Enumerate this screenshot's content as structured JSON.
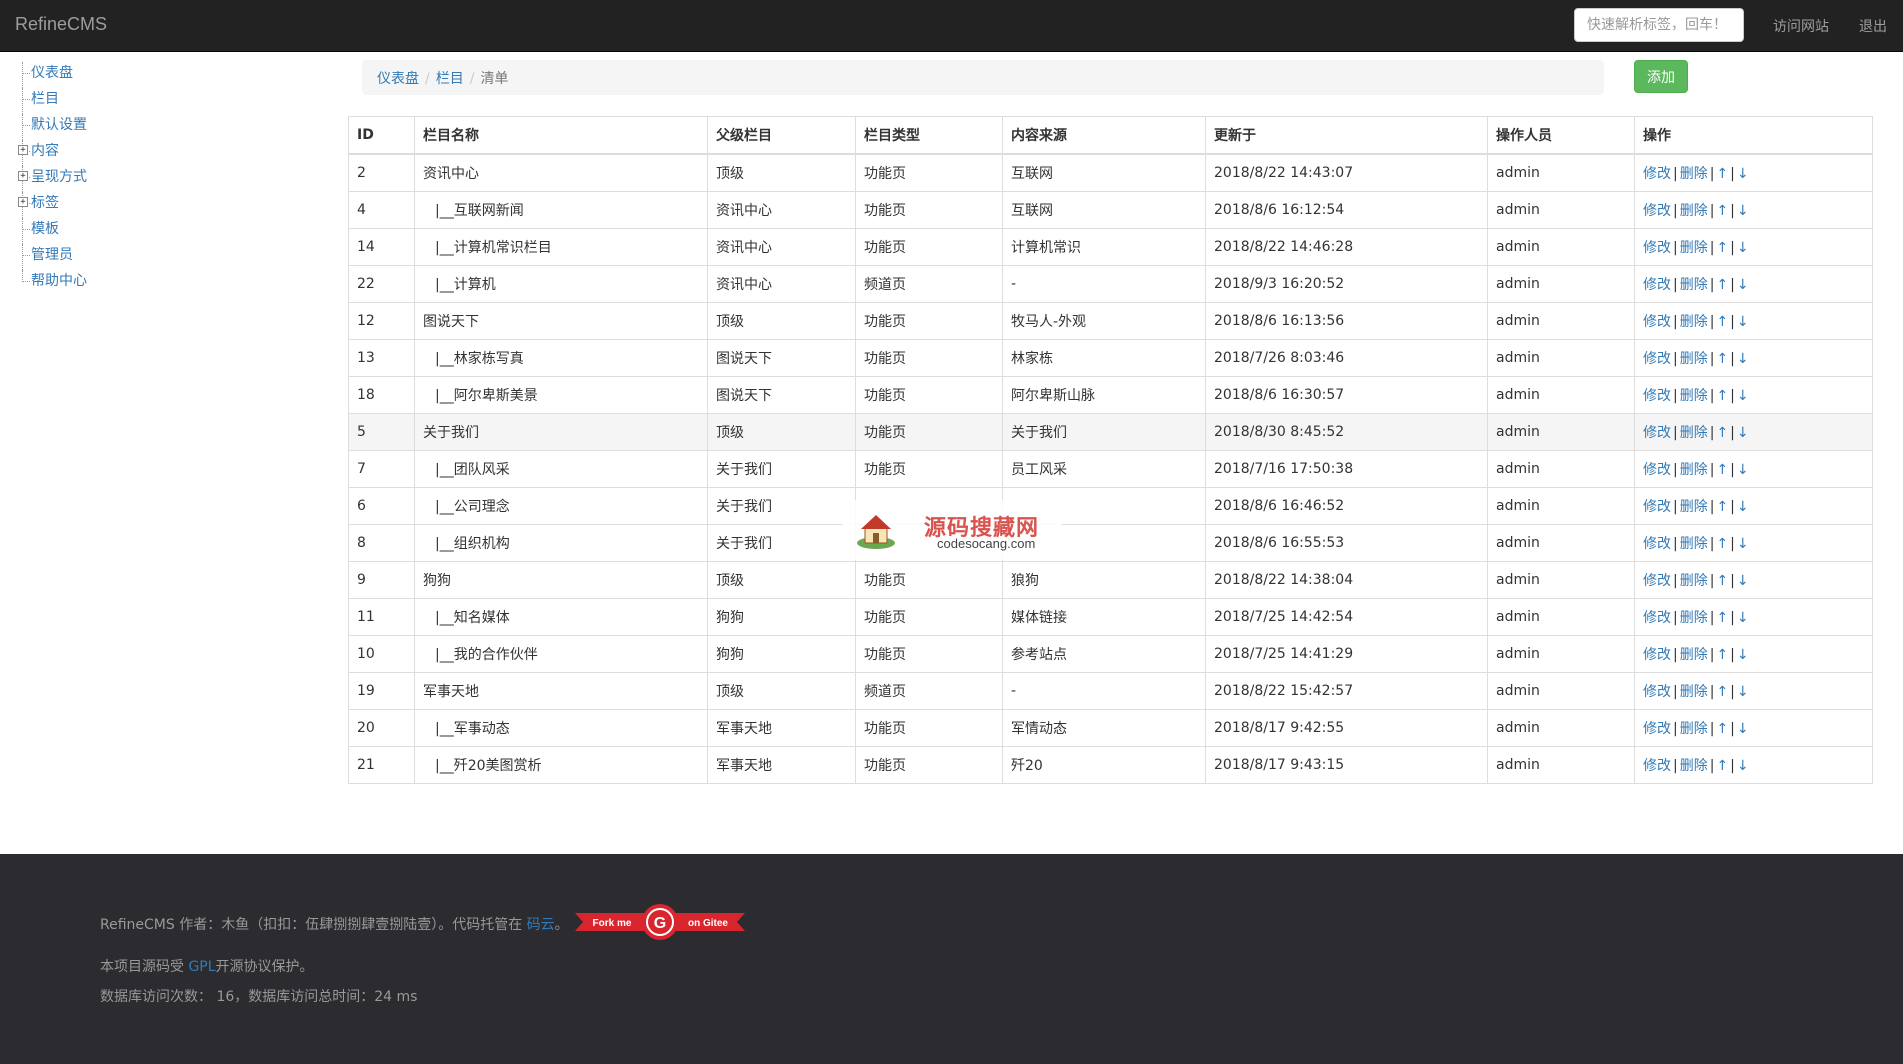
{
  "app": {
    "brand": "RefineCMS",
    "search_placeholder": "快速解析标签，回车！",
    "visit_site": "访问网站",
    "logout": "退出"
  },
  "sidebar": {
    "items": [
      {
        "label": "仪表盘",
        "expandable": false
      },
      {
        "label": "栏目",
        "expandable": false
      },
      {
        "label": "默认设置",
        "expandable": false
      },
      {
        "label": "内容",
        "expandable": true
      },
      {
        "label": "呈现方式",
        "expandable": true
      },
      {
        "label": "标签",
        "expandable": true
      },
      {
        "label": "模板",
        "expandable": false
      },
      {
        "label": "管理员",
        "expandable": false
      },
      {
        "label": "帮助中心",
        "expandable": false
      }
    ],
    "expander_glyph": "+"
  },
  "breadcrumb": {
    "items": [
      "仪表盘",
      "栏目"
    ],
    "active": "清单",
    "separator": "/"
  },
  "toolbar": {
    "add_label": "添加"
  },
  "table": {
    "headers": [
      "ID",
      "栏目名称",
      "父级栏目",
      "栏目类型",
      "内容来源",
      "更新于",
      "操作人员",
      "操作"
    ],
    "ops": {
      "edit": "修改",
      "delete": "删除",
      "sep": "|",
      "up": "↑",
      "down": "↓"
    },
    "rows": [
      [
        "2",
        "资讯中心",
        "顶级",
        "功能页",
        "互联网",
        "2018/8/22 14:43:07",
        "admin"
      ],
      [
        "4",
        "|__互联网新闻",
        "资讯中心",
        "功能页",
        "互联网",
        "2018/8/6 16:12:54",
        "admin"
      ],
      [
        "14",
        "|__计算机常识栏目",
        "资讯中心",
        "功能页",
        "计算机常识",
        "2018/8/22 14:46:28",
        "admin"
      ],
      [
        "22",
        "|__计算机",
        "资讯中心",
        "频道页",
        "-",
        "2018/9/3 16:20:52",
        "admin"
      ],
      [
        "12",
        "图说天下",
        "顶级",
        "功能页",
        "牧马人-外观",
        "2018/8/6 16:13:56",
        "admin"
      ],
      [
        "13",
        "|__林家栋写真",
        "图说天下",
        "功能页",
        "林家栋",
        "2018/7/26 8:03:46",
        "admin"
      ],
      [
        "18",
        "|__阿尔卑斯美景",
        "图说天下",
        "功能页",
        "阿尔卑斯山脉",
        "2018/8/6 16:30:57",
        "admin"
      ],
      [
        "5",
        "关于我们",
        "顶级",
        "功能页",
        "关于我们",
        "2018/8/30 8:45:52",
        "admin"
      ],
      [
        "7",
        "|__团队风采",
        "关于我们",
        "功能页",
        "员工风采",
        "2018/7/16 17:50:38",
        "admin"
      ],
      [
        "6",
        "|__公司理念",
        "关于我们",
        "",
        "",
        "2018/8/6 16:46:52",
        "admin"
      ],
      [
        "8",
        "|__组织机构",
        "关于我们",
        "",
        "",
        "2018/8/6 16:55:53",
        "admin"
      ],
      [
        "9",
        "狗狗",
        "顶级",
        "功能页",
        "狼狗",
        "2018/8/22 14:38:04",
        "admin"
      ],
      [
        "11",
        "|__知名媒体",
        "狗狗",
        "功能页",
        "媒体链接",
        "2018/7/25 14:42:54",
        "admin"
      ],
      [
        "10",
        "|__我的合作伙伴",
        "狗狗",
        "功能页",
        "参考站点",
        "2018/7/25 14:41:29",
        "admin"
      ],
      [
        "19",
        "军事天地",
        "顶级",
        "频道页",
        "-",
        "2018/8/22 15:42:57",
        "admin"
      ],
      [
        "20",
        "|__军事动态",
        "军事天地",
        "功能页",
        "军情动态",
        "2018/8/17 9:42:55",
        "admin"
      ],
      [
        "21",
        "|__歼20美图赏析",
        "军事天地",
        "功能页",
        "歼20",
        "2018/8/17 9:43:15",
        "admin"
      ]
    ],
    "highlighted_row_index": 7
  },
  "watermark": {
    "title": "源码搜藏网",
    "subtitle": "codesocang.com"
  },
  "footer": {
    "line1_text": "RefineCMS 作者：木鱼（扣扣：伍肆捌捌肆壹捌陆壹）。代码托管在 ",
    "line1_link": "码云",
    "line1_end": "。",
    "ribbon_left": "Fork me",
    "ribbon_right": "on Gitee",
    "ribbon_logo": "G",
    "line2_pre": "本项目源码受 ",
    "line2_link": "GPL",
    "line2_post": "开源协议保护。",
    "line3": "数据库访问次数： 16，数据库访问总时间：24 ms"
  },
  "colors": {
    "navbar_bg": "#222222",
    "link": "#337ab7",
    "add_button": "#5cb85c",
    "footer_bg": "#2b2b30",
    "ribbon": "#d9262e"
  }
}
